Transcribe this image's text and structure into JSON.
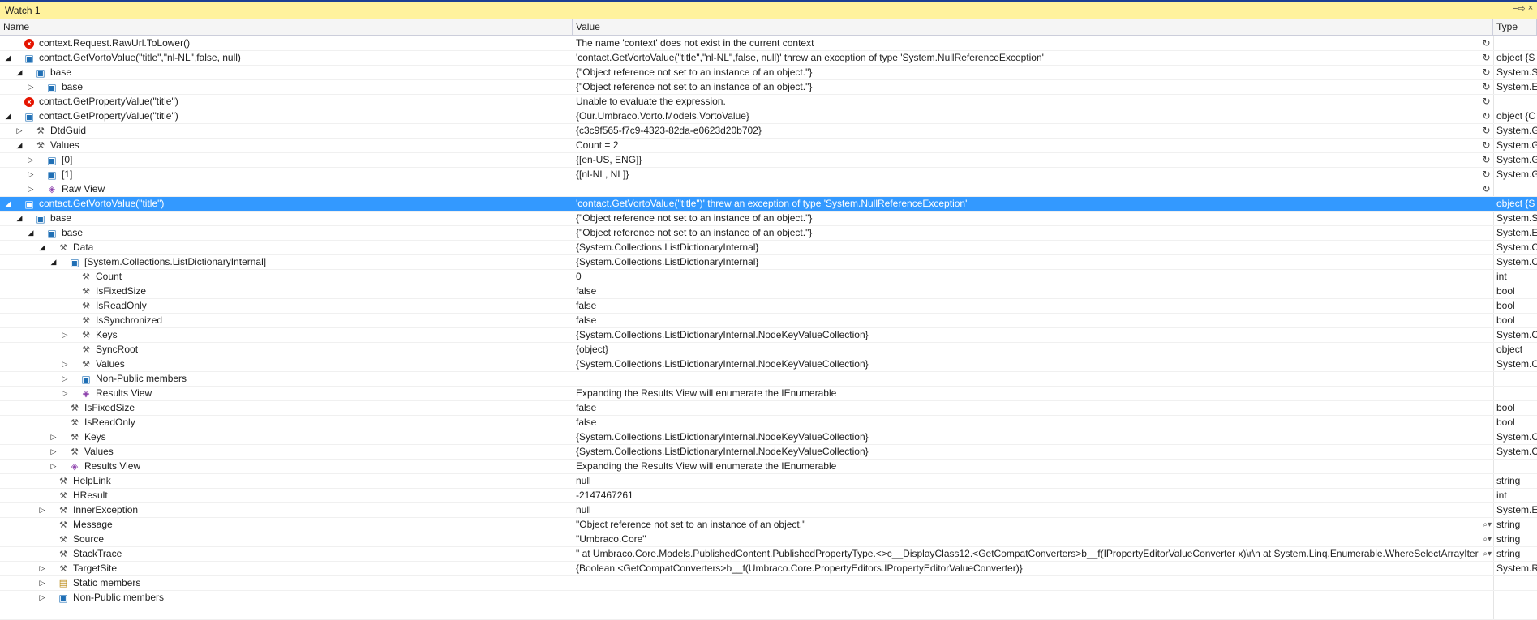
{
  "window": {
    "title": "Watch 1",
    "pin": "−⇨",
    "close": "×"
  },
  "columns": {
    "name": "Name",
    "value": "Value",
    "type": "Type"
  },
  "rows": [
    {
      "depth": 0,
      "exp": "",
      "icon": "err",
      "name": "context.Request.RawUrl.ToLower()",
      "value": "The name 'context' does not exist in the current context",
      "type": "",
      "refresh": true
    },
    {
      "depth": 0,
      "exp": "open",
      "icon": "obj",
      "name": "contact.GetVortoValue(\"title\",\"nl-NL\",false, null)",
      "value": "'contact.GetVortoValue(\"title\",\"nl-NL\",false, null)' threw an exception of type 'System.NullReferenceException'",
      "type": "object {S",
      "refresh": true
    },
    {
      "depth": 1,
      "exp": "open",
      "icon": "obj",
      "name": "base",
      "value": "{\"Object reference not set to an instance of an object.\"}",
      "type": "System.S",
      "refresh": true
    },
    {
      "depth": 2,
      "exp": "closed",
      "icon": "obj",
      "name": "base",
      "value": "{\"Object reference not set to an instance of an object.\"}",
      "type": "System.E",
      "refresh": true
    },
    {
      "depth": 0,
      "exp": "",
      "icon": "err",
      "name": "contact.GetPropertyValue(\"title\")",
      "value": "Unable to evaluate the expression.",
      "type": "",
      "refresh": true
    },
    {
      "depth": 0,
      "exp": "open",
      "icon": "obj",
      "name": "contact.GetPropertyValue(\"title\")",
      "value": "{Our.Umbraco.Vorto.Models.VortoValue}",
      "type": "object {C",
      "refresh": true
    },
    {
      "depth": 1,
      "exp": "closed",
      "icon": "wrench",
      "name": "DtdGuid",
      "value": "{c3c9f565-f7c9-4323-82da-e0623d20b702}",
      "type": "System.G",
      "refresh": true
    },
    {
      "depth": 1,
      "exp": "open",
      "icon": "wrench",
      "name": "Values",
      "value": "Count = 2",
      "type": "System.G",
      "refresh": true
    },
    {
      "depth": 2,
      "exp": "closed",
      "icon": "obj",
      "name": "[0]",
      "value": "{[en-US, ENG]}",
      "type": "System.G",
      "refresh": true
    },
    {
      "depth": 2,
      "exp": "closed",
      "icon": "obj",
      "name": "[1]",
      "value": "{[nl-NL, NL]}",
      "type": "System.G",
      "refresh": true
    },
    {
      "depth": 2,
      "exp": "closed",
      "icon": "results",
      "name": "Raw View",
      "value": "",
      "type": "",
      "refresh": true
    },
    {
      "depth": 0,
      "exp": "open",
      "icon": "obj",
      "name": "contact.GetVortoValue(\"title\")",
      "value": "'contact.GetVortoValue(\"title\")' threw an exception of type 'System.NullReferenceException'",
      "type": "object {S",
      "refresh": false,
      "selected": true
    },
    {
      "depth": 1,
      "exp": "open",
      "icon": "obj",
      "name": "base",
      "value": "{\"Object reference not set to an instance of an object.\"}",
      "type": "System.S"
    },
    {
      "depth": 2,
      "exp": "open",
      "icon": "obj",
      "name": "base",
      "value": "{\"Object reference not set to an instance of an object.\"}",
      "type": "System.E"
    },
    {
      "depth": 3,
      "exp": "open",
      "icon": "wrench",
      "name": "Data",
      "value": "{System.Collections.ListDictionaryInternal}",
      "type": "System.C"
    },
    {
      "depth": 4,
      "exp": "open",
      "icon": "obj",
      "name": "[System.Collections.ListDictionaryInternal]",
      "value": "{System.Collections.ListDictionaryInternal}",
      "type": "System.C"
    },
    {
      "depth": 5,
      "exp": "",
      "icon": "wrench",
      "name": "Count",
      "value": "0",
      "type": "int"
    },
    {
      "depth": 5,
      "exp": "",
      "icon": "wrench",
      "name": "IsFixedSize",
      "value": "false",
      "type": "bool"
    },
    {
      "depth": 5,
      "exp": "",
      "icon": "wrench",
      "name": "IsReadOnly",
      "value": "false",
      "type": "bool"
    },
    {
      "depth": 5,
      "exp": "",
      "icon": "wrench",
      "name": "IsSynchronized",
      "value": "false",
      "type": "bool"
    },
    {
      "depth": 5,
      "exp": "closed",
      "icon": "wrench",
      "name": "Keys",
      "value": "{System.Collections.ListDictionaryInternal.NodeKeyValueCollection}",
      "type": "System.C"
    },
    {
      "depth": 5,
      "exp": "",
      "icon": "wrench",
      "name": "SyncRoot",
      "value": "{object}",
      "type": "object"
    },
    {
      "depth": 5,
      "exp": "closed",
      "icon": "wrench",
      "name": "Values",
      "value": "{System.Collections.ListDictionaryInternal.NodeKeyValueCollection}",
      "type": "System.C"
    },
    {
      "depth": 5,
      "exp": "closed",
      "icon": "obj",
      "name": "Non-Public members",
      "value": "",
      "type": ""
    },
    {
      "depth": 5,
      "exp": "closed",
      "icon": "results",
      "name": "Results View",
      "value": "Expanding the Results View will enumerate the IEnumerable",
      "type": ""
    },
    {
      "depth": 4,
      "exp": "",
      "icon": "wrench",
      "name": "IsFixedSize",
      "value": "false",
      "type": "bool"
    },
    {
      "depth": 4,
      "exp": "",
      "icon": "wrench",
      "name": "IsReadOnly",
      "value": "false",
      "type": "bool"
    },
    {
      "depth": 4,
      "exp": "closed",
      "icon": "wrench",
      "name": "Keys",
      "value": "{System.Collections.ListDictionaryInternal.NodeKeyValueCollection}",
      "type": "System.C"
    },
    {
      "depth": 4,
      "exp": "closed",
      "icon": "wrench",
      "name": "Values",
      "value": "{System.Collections.ListDictionaryInternal.NodeKeyValueCollection}",
      "type": "System.C"
    },
    {
      "depth": 4,
      "exp": "closed",
      "icon": "results",
      "name": "Results View",
      "value": "Expanding the Results View will enumerate the IEnumerable",
      "type": ""
    },
    {
      "depth": 3,
      "exp": "",
      "icon": "wrench",
      "name": "HelpLink",
      "value": "null",
      "type": "string"
    },
    {
      "depth": 3,
      "exp": "",
      "icon": "wrench",
      "name": "HResult",
      "value": "-2147467261",
      "type": "int"
    },
    {
      "depth": 3,
      "exp": "closed",
      "icon": "wrench",
      "name": "InnerException",
      "value": "null",
      "type": "System.E"
    },
    {
      "depth": 3,
      "exp": "",
      "icon": "wrench",
      "name": "Message",
      "value": "\"Object reference not set to an instance of an object.\"",
      "type": "string",
      "magnifier": true
    },
    {
      "depth": 3,
      "exp": "",
      "icon": "wrench",
      "name": "Source",
      "value": "\"Umbraco.Core\"",
      "type": "string",
      "magnifier": true
    },
    {
      "depth": 3,
      "exp": "",
      "icon": "wrench",
      "name": "StackTrace",
      "value": "\"   at Umbraco.Core.Models.PublishedContent.PublishedPropertyType.<>c__DisplayClass12.<GetCompatConverters>b__f(IPropertyEditorValueConverter x)\\r\\n   at System.Linq.Enumerable.WhereSelectArrayIter",
      "type": "string",
      "magnifier": true
    },
    {
      "depth": 3,
      "exp": "closed",
      "icon": "wrench",
      "name": "TargetSite",
      "value": "{Boolean <GetCompatConverters>b__f(Umbraco.Core.PropertyEditors.IPropertyEditorValueConverter)}",
      "type": "System.R"
    },
    {
      "depth": 3,
      "exp": "closed",
      "icon": "static",
      "name": "Static members",
      "value": "",
      "type": ""
    },
    {
      "depth": 3,
      "exp": "closed",
      "icon": "obj",
      "name": "Non-Public members",
      "value": "",
      "type": ""
    },
    {
      "depth": 0,
      "exp": "",
      "icon": "",
      "name": "",
      "value": "",
      "type": ""
    }
  ],
  "icons": {
    "err": "error-icon",
    "obj": "object-icon",
    "wrench": "property-icon",
    "results": "results-view-icon",
    "static": "static-members-icon",
    "refresh": "refresh-icon",
    "magnifier": "text-visualizer-icon"
  },
  "colors": {
    "title_bg": "#fff29d",
    "selection": "#3399ff",
    "error": "#e51400"
  }
}
